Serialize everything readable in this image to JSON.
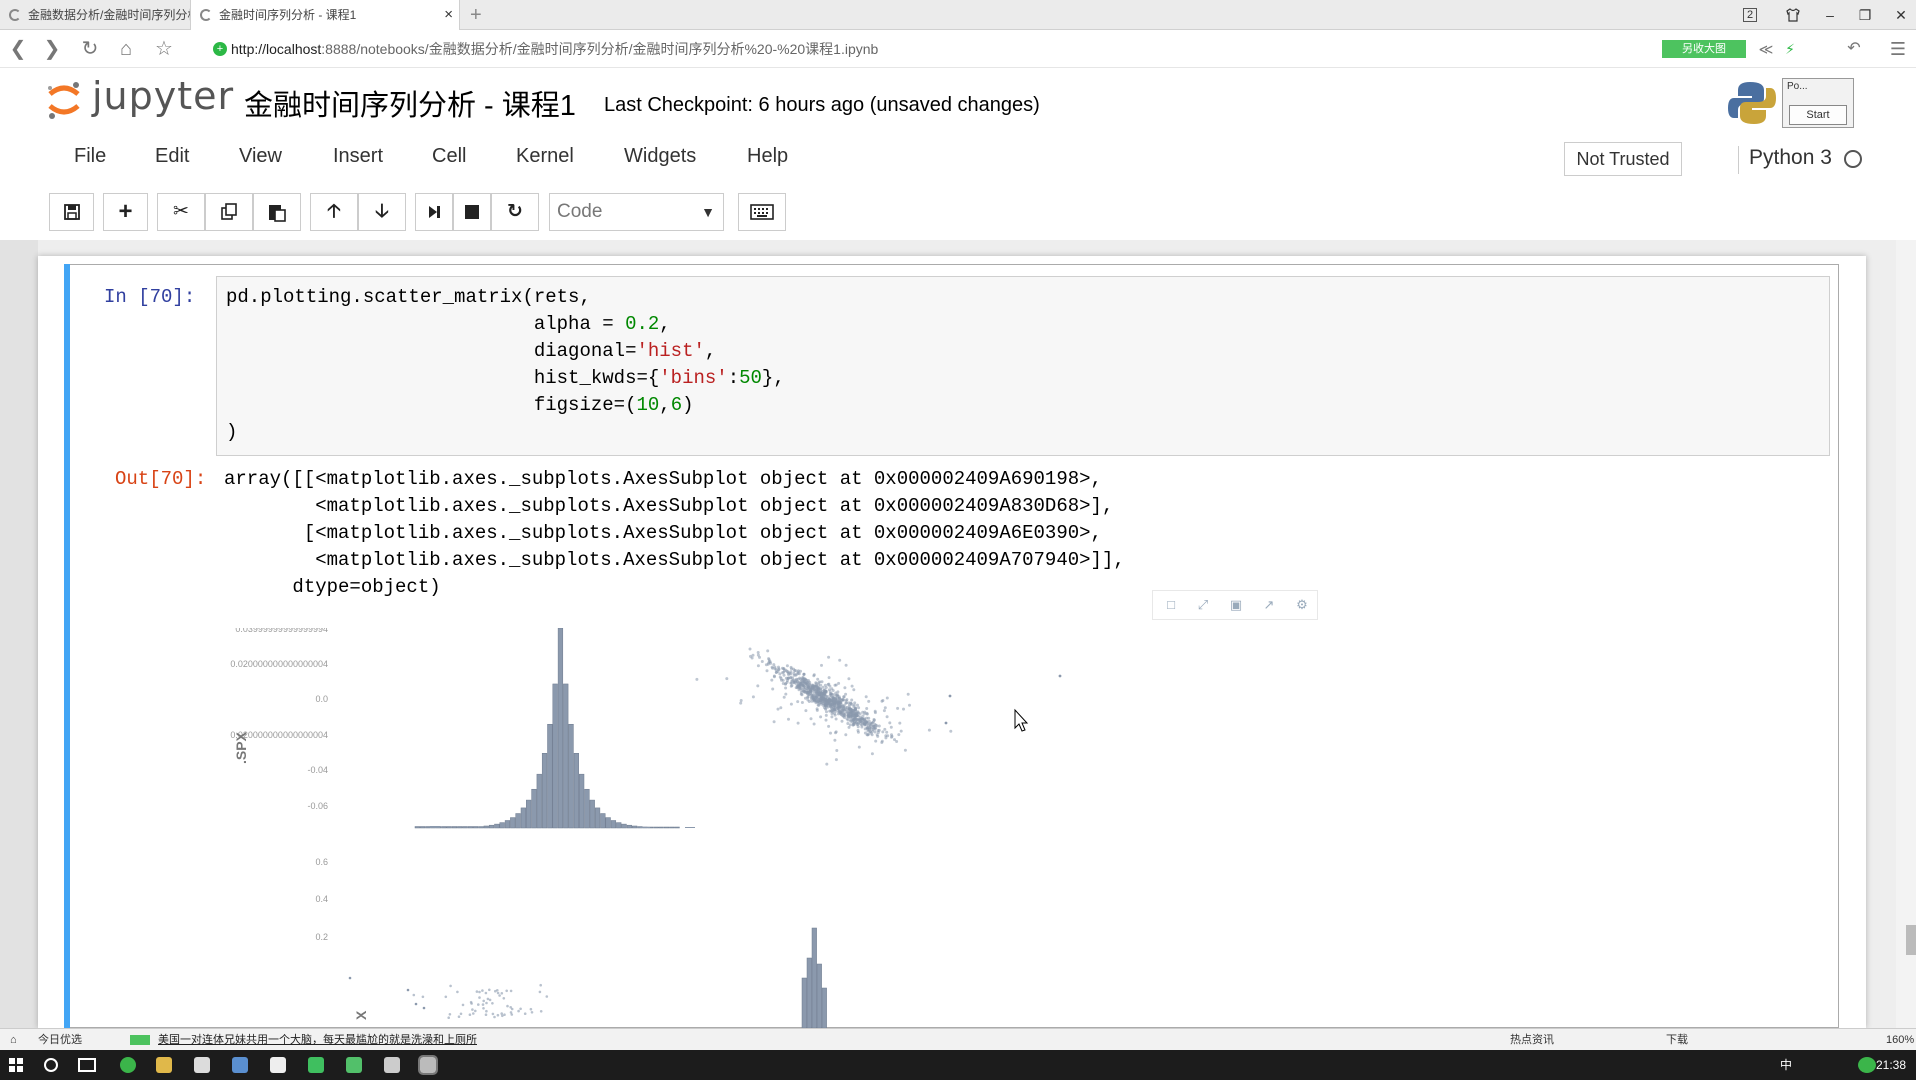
{
  "browser": {
    "tabs": [
      {
        "label": "金融数据分析/金融时间序列分析"
      },
      {
        "label": "金融时间序列分析 - 课程1"
      }
    ],
    "tab_close": "×",
    "new_tab": "+",
    "url_host": "http://localhost",
    "url_rest": ":8888/notebooks/金融数据分析/金融时间序列分析/金融时间序列分析%20-%20课程1.ipynb",
    "green_button": "另收大图",
    "window_badge": "2"
  },
  "jupyter": {
    "logo_text": "jupyter",
    "notebook_title": "金融时间序列分析 - 课程1",
    "checkpoint": "Last Checkpoint: 6 hours ago (unsaved changes)",
    "popup_label": "Po...",
    "popup_button": "Start",
    "menu": [
      "File",
      "Edit",
      "View",
      "Insert",
      "Cell",
      "Kernel",
      "Widgets",
      "Help"
    ],
    "trust_status": "Not Trusted",
    "kernel_name": "Python 3",
    "cell_type": "Code"
  },
  "cell": {
    "in_prompt": "In  [70]:",
    "out_prompt": "Out[70]:",
    "code": {
      "l1": "pd.plotting.scatter_matrix(rets,",
      "l2a": "                           alpha = ",
      "l2b": "0.2",
      "l2c": ",",
      "l3a": "                           diagonal=",
      "l3b": "'hist'",
      "l3c": ",",
      "l4a": "                           hist_kwds={",
      "l4b": "'bins'",
      "l4c": ":",
      "l4d": "50",
      "l4e": "},",
      "l5a": "                           figsize=(",
      "l5b": "10",
      "l5c": ",",
      "l5d": "6",
      "l5e": ")",
      "l6": ")"
    },
    "output": [
      "array([[<matplotlib.axes._subplots.AxesSubplot object at 0x000002409A690198>,",
      "        <matplotlib.axes._subplots.AxesSubplot object at 0x000002409A830D68>],",
      "       [<matplotlib.axes._subplots.AxesSubplot object at 0x000002409A6E0390>,",
      "        <matplotlib.axes._subplots.AxesSubplot object at 0x000002409A707940>]],",
      "      dtype=object)"
    ]
  },
  "chart_data": {
    "type": "scatter",
    "title": "",
    "ylabel": ".SPX",
    "ytick_labels_row1": [
      "0.03999999999999994",
      "0.020000000000000004",
      "0.0",
      "-0.020000000000000004",
      "-0.04",
      "-0.06"
    ],
    "ytick_labels_row2": [
      "0.6",
      "0.4",
      "0.2"
    ],
    "ylabel_row2": "X",
    "panels": [
      "hist .SPX",
      "scatter .SPX vs other",
      "scatter other vs .SPX",
      "hist other"
    ]
  },
  "statusbar": {
    "left_label": "今日优选",
    "news": "美国一对连体兄妹共用一个大脑，每天最尴尬的就是洗澡和上厕所",
    "hot": "热点资讯",
    "download": "下载",
    "zoom": "160%"
  },
  "taskbar": {
    "ime": "中",
    "clock": "21:38"
  }
}
